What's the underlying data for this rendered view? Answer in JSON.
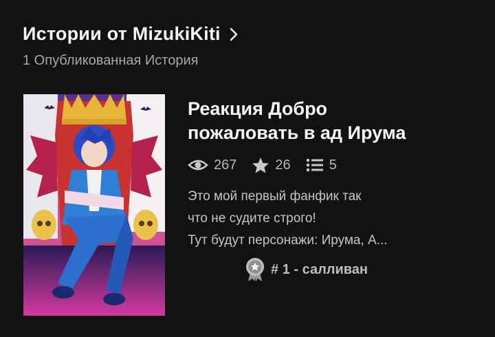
{
  "header": {
    "title": "Истории от MizukiKiti",
    "subtitle": "1 Опубликованная История"
  },
  "story": {
    "title_line1": "Реакция Добро",
    "title_line2": "пожаловать в ад Ирума",
    "views": "267",
    "votes": "26",
    "parts": "5",
    "description_lines": [
      "Это мой первый фанфик так",
      "что не судите строго!",
      "Тут будут персонажи: Ирума, А..."
    ],
    "ranking": "# 1 - салливан"
  },
  "icons": {
    "views": "eye-icon",
    "votes": "star-icon",
    "parts": "list-icon",
    "ranking": "ribbon-badge-icon",
    "header": "chevron-right-icon"
  }
}
